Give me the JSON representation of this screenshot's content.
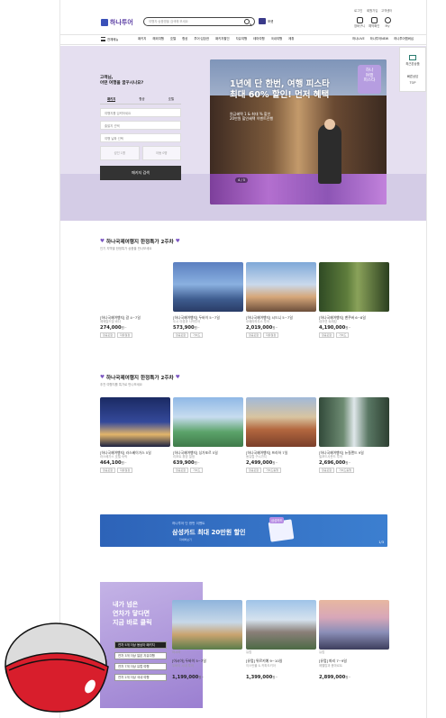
{
  "header": {
    "top_links": [
      "로그인",
      "회원가입",
      "고객센터"
    ],
    "logo": "하나투어",
    "search_placeholder": "여행지·상품명을 검색해 보세요",
    "quick_btn": "포켓",
    "icons": [
      {
        "name": "cart-icon",
        "label": "장바구니"
      },
      {
        "name": "ticket-icon",
        "label": "예약확인"
      },
      {
        "name": "user-icon",
        "label": "My"
      }
    ]
  },
  "gnb": {
    "allcat": "전체메뉴",
    "menu": [
      "패키지",
      "해외여행",
      "호텔",
      "항공",
      "투어·입장권",
      "패키지할인",
      "자유여행",
      "테마여행",
      "국내여행",
      "제휴"
    ],
    "right": [
      "하나LIVE",
      "하나투어NEW",
      "하나투어멤버십"
    ]
  },
  "hero": {
    "question": "고객님,\n어떤 여행을 꿈꾸시나요?",
    "tabs": [
      "패키지",
      "항공",
      "호텔"
    ],
    "dest_placeholder": "여행지를 입력하세요",
    "depart_placeholder": "출발지 선택",
    "date_placeholder": "여행 날짜 선택",
    "pax": [
      "성인 1명",
      "아동 0명"
    ],
    "search_btn": "패키지 검색",
    "banner_title": "1년에 단 한번, 여행 피스타\n최대 60% 할인! 먼저 혜택",
    "banner_sub": "원금혜택 1 & 최대 % 할인\n20만원 할인혜택 이벤트진행",
    "banner_tag": "하나\n여행\n피스타",
    "pager": "4 / 5",
    "floating": [
      "최근본상품",
      "빠른상담",
      "TOP"
    ]
  },
  "sec1": {
    "title": "하나국제여행지 한정특가 2주차",
    "sub": "인기 지역별 한정특가 상품을 만나보세요",
    "cards": [
      {
        "name": "[하나국제여행지] 괌 4~7일",
        "desc": "에메랄드빛 바다",
        "price": "274,000",
        "unit": "원~",
        "tags": [
          "항공포함",
          "자유일정"
        ]
      },
      {
        "name": "[하나국제여행지] 두바이 5~7일",
        "desc": "도시 야경과 사막투어",
        "price": "573,900",
        "unit": "원~",
        "tags": [
          "항공포함",
          "가이드"
        ]
      },
      {
        "name": "[하나국제여행지] 시드니 5~7일",
        "desc": "오페라하우스 투어",
        "price": "2,019,000",
        "unit": "원~",
        "tags": [
          "항공포함",
          "자유일정"
        ]
      },
      {
        "name": "[하나국제여행지] 밴쿠버 6~8일",
        "desc": "대자연 트래킹",
        "price": "4,190,000",
        "unit": "원~",
        "tags": [
          "항공포함",
          "가이드"
        ]
      }
    ]
  },
  "sec2": {
    "title": "하나국제여행지 한정특가 2주차",
    "sub": "추천 여행지를 특가로 만나보세요",
    "cards": [
      {
        "name": "[하나국제여행지] 라스베이거스 5일",
        "desc": "라스베가스 호텔 숙박",
        "price": "464,100",
        "unit": "원~",
        "tags": [
          "항공포함",
          "자유일정"
        ]
      },
      {
        "name": "[하나국제여행지] 싱가포르 5일",
        "desc": "리조트 휴양 일정",
        "price": "639,900",
        "unit": "원~",
        "tags": [
          "항공포함",
          "가이드"
        ]
      },
      {
        "name": "[하나국제여행지] 프라하 7일",
        "desc": "동유럽 구시가지",
        "price": "2,499,000",
        "unit": "원~",
        "tags": [
          "항공포함",
          "가이드동행"
        ]
      },
      {
        "name": "[하나국제여행지] 뉴질랜드 9일",
        "desc": "밀포드사운드 투어",
        "price": "2,696,000",
        "unit": "원~",
        "tags": [
          "항공포함",
          "가이드동행"
        ]
      }
    ]
  },
  "promo": {
    "line1": "하나투어 단 한번 이벤트",
    "line2": "삼성카드 최대 20만원 할인",
    "line3": "자세히보기",
    "badge": "삼성카드",
    "page": "1/3"
  },
  "sec3": {
    "side_title": "내가 넘은\n연차가 닿다면\n지금 바로 클릭",
    "options": [
      "연차 5개 이상 동남아 패키지",
      "연차 3개 이상 일본 자유여행",
      "연차 7개 이상 유럽 여행",
      "연차 2개 이상 국내 여행"
    ],
    "cards": [
      {
        "region": "아시아",
        "name": "[아시아] 두바이 5~7일",
        "desc": "두바이 시내 투어",
        "price": "1,199,000",
        "unit": "원~"
      },
      {
        "region": "유럽",
        "name": "[유럽] 튀르키예 9~10일",
        "desc": "이스탄불 & 카파도키아",
        "price": "1,399,000",
        "unit": "원~"
      },
      {
        "region": "유럽",
        "name": "[유럽] 파리 7~9일",
        "desc": "에펠탑과 몽마르트",
        "price": "2,899,000",
        "unit": "원~"
      }
    ]
  }
}
